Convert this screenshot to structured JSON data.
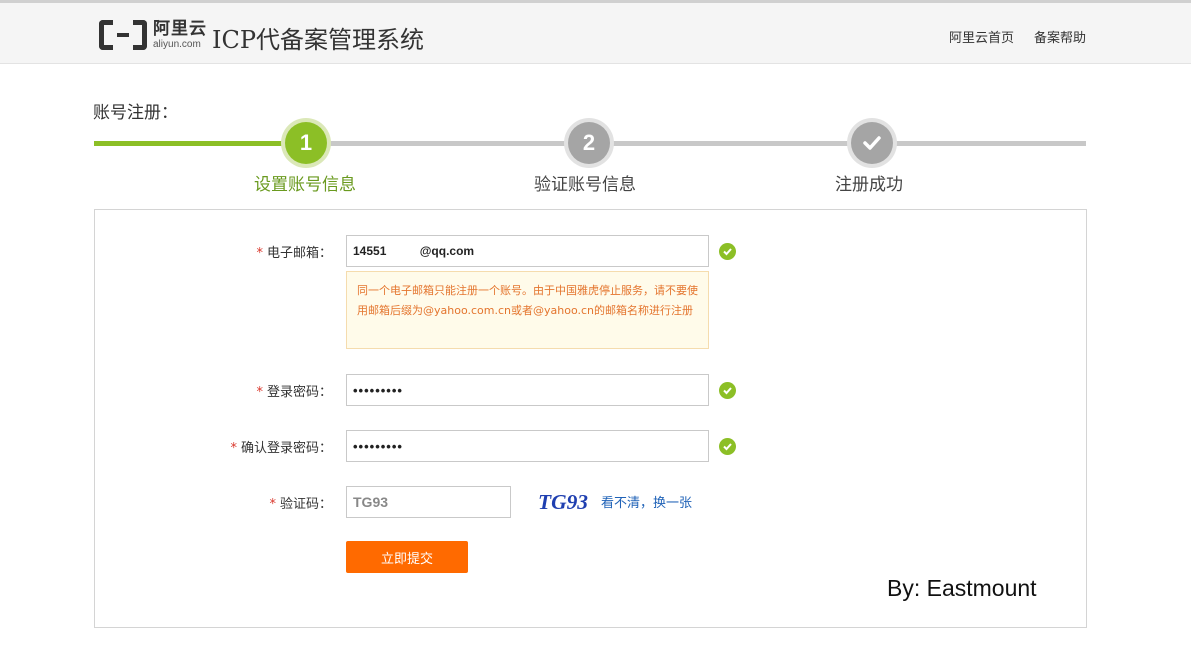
{
  "header": {
    "logo_cn": "阿里云",
    "logo_en": "aliyun.com",
    "title": "ICP代备案管理系统",
    "links": [
      "阿里云首页",
      "备案帮助"
    ]
  },
  "section_title": "账号注册：",
  "steps": [
    {
      "number": "1",
      "label": "设置账号信息",
      "state": "active"
    },
    {
      "number": "2",
      "label": "验证账号信息",
      "state": "pending"
    },
    {
      "number": "",
      "label": "注册成功",
      "state": "pending",
      "icon": "check-icon"
    }
  ],
  "form": {
    "required_mark": "*",
    "email": {
      "label": "电子邮箱：",
      "value": "14551          @qq.com",
      "valid": true
    },
    "email_hint": "同一个电子邮箱只能注册一个账号。由于中国雅虎停止服务，请不要使用邮箱后缀为@yahoo.com.cn或者@yahoo.cn的邮箱名称进行注册",
    "password": {
      "label": "登录密码：",
      "value": "•••••••••",
      "valid": true
    },
    "confirm_password": {
      "label": "确认登录密码：",
      "value": "•••••••••",
      "valid": true
    },
    "captcha": {
      "label": "验证码：",
      "value": "TG93",
      "image_text": "TG93",
      "refresh_label": "看不清，换一张"
    },
    "submit_label": "立即提交"
  },
  "watermark": "By: Eastmount",
  "colors": {
    "accent_green": "#8cbf26",
    "step_gray": "#a5a5a5",
    "submit_orange": "#ff6a00",
    "hint_text": "#e4752e",
    "link_blue": "#1f62b7"
  }
}
